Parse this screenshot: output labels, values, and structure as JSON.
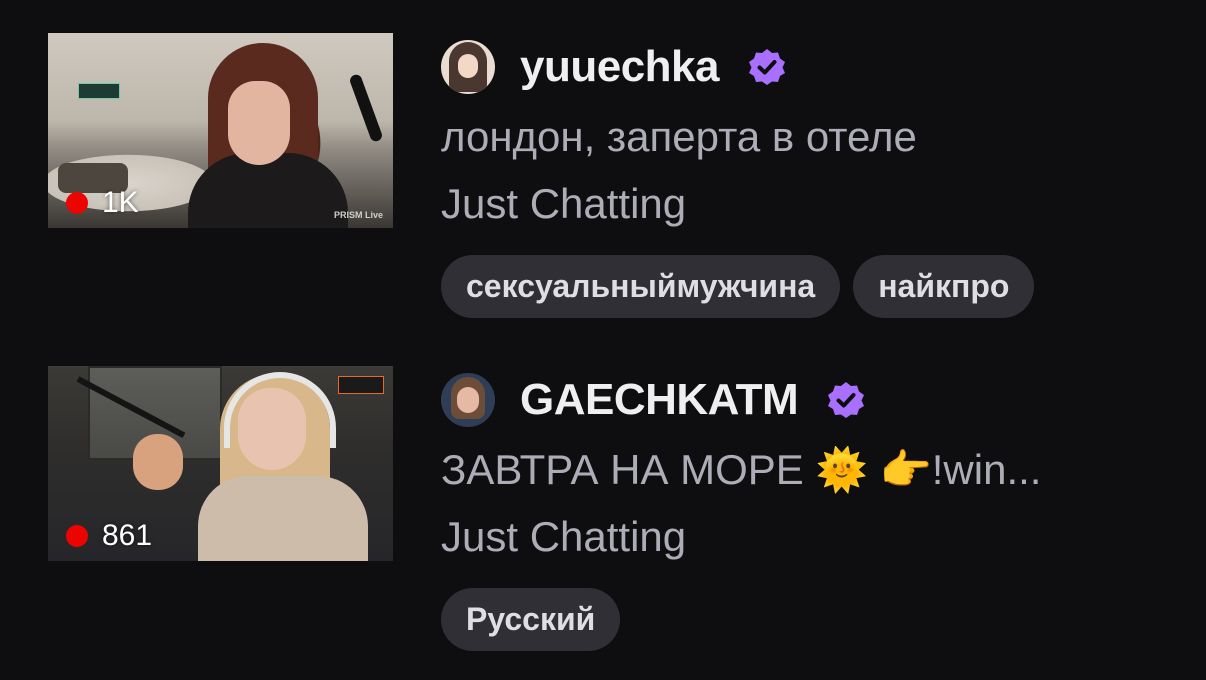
{
  "streams": [
    {
      "viewers": "1K",
      "thumbnail_overlay": "PRISM Live",
      "channel": "yuuechka",
      "verified": true,
      "title": "лондон, заперта в отеле",
      "category": "Just Chatting",
      "tags": [
        "сексуальныймужчина",
        "найкпро"
      ]
    },
    {
      "viewers": "861",
      "channel": "GAECHKATM",
      "verified": true,
      "title": "ЗАВТРА НА МОРЕ 🌞  👉!win...",
      "category": "Just Chatting",
      "tags": [
        "Русский"
      ]
    }
  ],
  "colors": {
    "background": "#0e0e10",
    "verified_badge": "#a970ff",
    "live_dot": "#eb0400",
    "tag_background": "#2f2f35",
    "secondary_text": "#adadb8"
  },
  "icons": {
    "verified": "verified-check-icon",
    "live": "live-dot-icon"
  }
}
